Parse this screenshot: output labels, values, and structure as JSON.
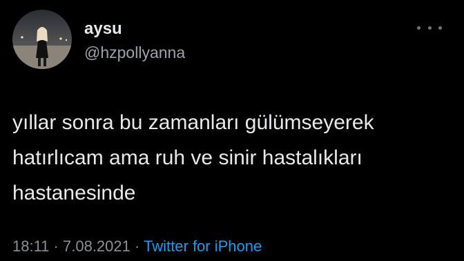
{
  "tweet": {
    "user": {
      "display_name": "aysu",
      "handle": "@hzpollyanna",
      "avatar_icon": "profile-photo"
    },
    "more_icon": "ellipsis-icon",
    "text_lines": [
      "yıllar sonra bu zamanları gülümseyerek",
      "hatırlıcam ama ruh ve sinir hastalıkları",
      "hastanesinde"
    ],
    "time": "18:11",
    "separator": "·",
    "date": "7.08.2021",
    "source": "Twitter for iPhone"
  },
  "colors": {
    "background": "#000000",
    "text": "#e7e9ea",
    "secondary": "#9ea3a8",
    "link": "#1d9bf0"
  }
}
